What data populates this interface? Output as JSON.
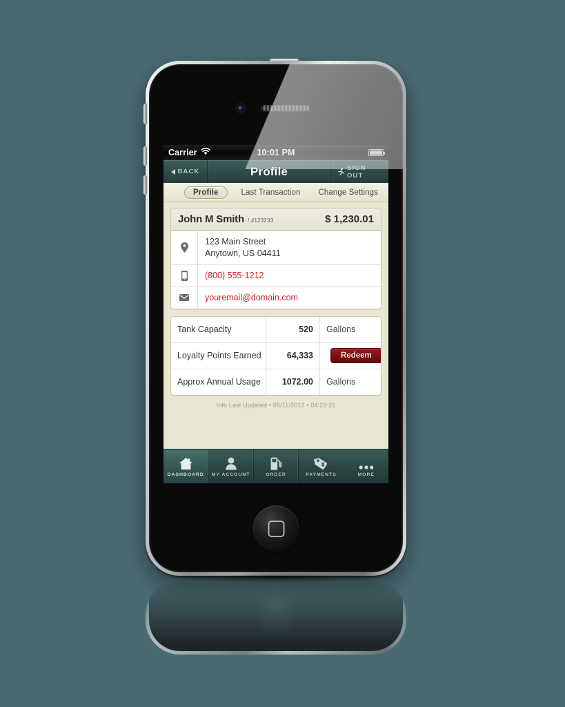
{
  "colors": {
    "background": "#4a6a72",
    "navbar": "#2f4c49",
    "content_bg": "#e9e7d4",
    "link_red": "#cc2127",
    "redeem_red": "#7c0d10",
    "tabbar_bg": "#2c4745"
  },
  "status_bar": {
    "carrier": "Carrier",
    "wifi_icon": "wifi-icon",
    "time": "10:01 PM",
    "battery_icon": "battery-icon"
  },
  "navbar": {
    "back_label": "BACK",
    "back_icon": "chevron-left-icon",
    "title": "Profile",
    "signout_label": "SIGN OUT",
    "signout_icon": "running-man-icon"
  },
  "tabs": [
    {
      "label": "Profile",
      "active": true
    },
    {
      "label": "Last Transaction",
      "active": false
    },
    {
      "label": "Change Settings",
      "active": false
    }
  ],
  "customer": {
    "name": "John M Smith",
    "separator": "/",
    "id": "#123233",
    "balance": "$ 1,230.01"
  },
  "contact": [
    {
      "icon": "map-pin-icon",
      "line1": "123 Main Street",
      "line2": "Anytown, US 04411",
      "is_link": false
    },
    {
      "icon": "mobile-phone-icon",
      "line1": "(800) 555-1212",
      "line2": "",
      "is_link": true
    },
    {
      "icon": "envelope-icon",
      "line1": "youremail@domain.com",
      "line2": "",
      "is_link": true
    }
  ],
  "stats": [
    {
      "label": "Tank Capacity",
      "value": "520",
      "unit": "Gallons",
      "action": ""
    },
    {
      "label": "Loyalty Points Earned",
      "value": "64,333",
      "unit": "",
      "action": "Redeem"
    },
    {
      "label": "Approx Annual Usage",
      "value": "1072.00",
      "unit": "Gallons",
      "action": ""
    }
  ],
  "updated_text": "Info Last Updated • 05/11/2012 • 04:23:21",
  "bottom_tabs": [
    {
      "label": "DASHBOARD",
      "icon": "home-icon",
      "active": true
    },
    {
      "label": "MY ACCOUNT",
      "icon": "person-icon",
      "active": false
    },
    {
      "label": "ORDER",
      "icon": "fuel-pump-icon",
      "active": false
    },
    {
      "label": "PAYMENTS",
      "icon": "price-tag-icon",
      "active": false
    },
    {
      "label": "MORE",
      "icon": "ellipsis-icon",
      "active": false
    }
  ]
}
